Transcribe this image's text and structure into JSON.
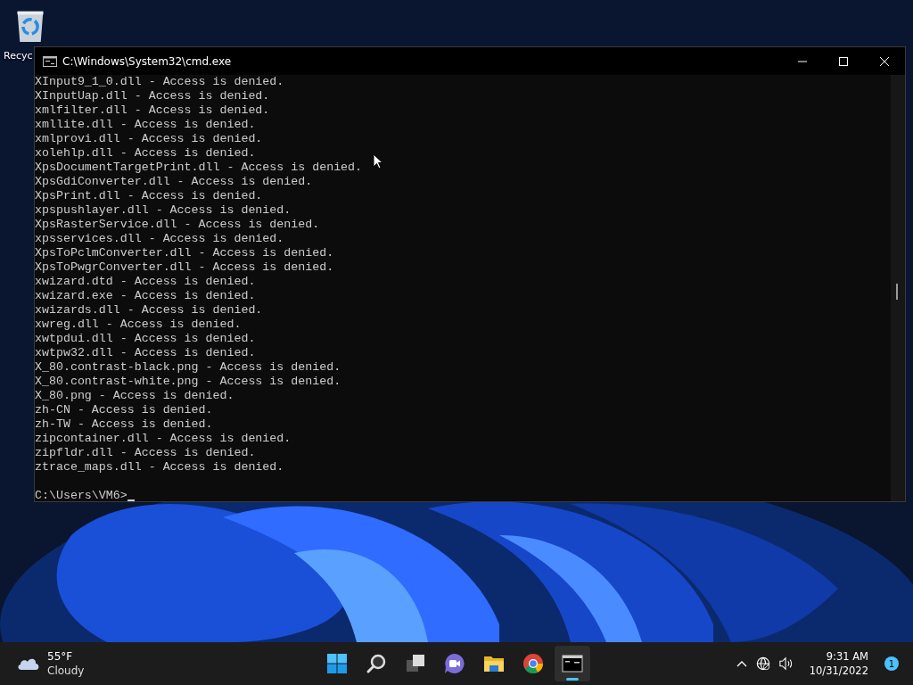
{
  "desktop": {
    "icons": [
      {
        "label": "Recyc"
      }
    ]
  },
  "window": {
    "title": "C:\\Windows\\System32\\cmd.exe",
    "output_lines": [
      "XInput9_1_0.dll - Access is denied.",
      "XInputUap.dll - Access is denied.",
      "xmlfilter.dll - Access is denied.",
      "xmllite.dll - Access is denied.",
      "xmlprovi.dll - Access is denied.",
      "xolehlp.dll - Access is denied.",
      "XpsDocumentTargetPrint.dll - Access is denied.",
      "XpsGdiConverter.dll - Access is denied.",
      "XpsPrint.dll - Access is denied.",
      "xpspushlayer.dll - Access is denied.",
      "XpsRasterService.dll - Access is denied.",
      "xpsservices.dll - Access is denied.",
      "XpsToPclmConverter.dll - Access is denied.",
      "XpsToPwgrConverter.dll - Access is denied.",
      "xwizard.dtd - Access is denied.",
      "xwizard.exe - Access is denied.",
      "xwizards.dll - Access is denied.",
      "xwreg.dll - Access is denied.",
      "xwtpdui.dll - Access is denied.",
      "xwtpw32.dll - Access is denied.",
      "X_80.contrast-black.png - Access is denied.",
      "X_80.contrast-white.png - Access is denied.",
      "X_80.png - Access is denied.",
      "zh-CN - Access is denied.",
      "zh-TW - Access is denied.",
      "zipcontainer.dll - Access is denied.",
      "zipfldr.dll - Access is denied.",
      "ztrace_maps.dll - Access is denied."
    ],
    "prompt": "C:\\Users\\VM6>"
  },
  "taskbar": {
    "weather": {
      "temperature": "55°F",
      "condition": "Cloudy"
    },
    "apps": [
      {
        "kind": "start",
        "active": false
      },
      {
        "kind": "search",
        "active": false
      },
      {
        "kind": "taskview",
        "active": false
      },
      {
        "kind": "chat",
        "active": false
      },
      {
        "kind": "explorer",
        "active": false
      },
      {
        "kind": "chrome",
        "active": false
      },
      {
        "kind": "terminal",
        "active": true
      }
    ],
    "clock": {
      "time": "9:31 AM",
      "date": "10/31/2022"
    },
    "notifications": "1"
  }
}
